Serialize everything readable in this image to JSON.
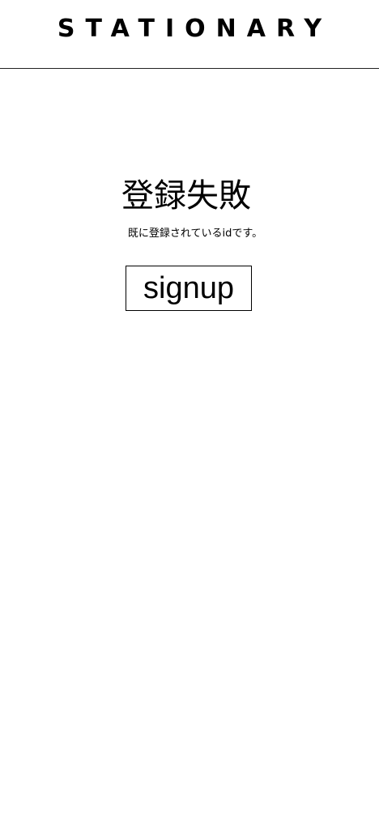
{
  "header": {
    "logo_text": "STATIONARY"
  },
  "main": {
    "heading": "登録失敗",
    "message": "既に登録されているidです。",
    "signup_label": "signup"
  }
}
